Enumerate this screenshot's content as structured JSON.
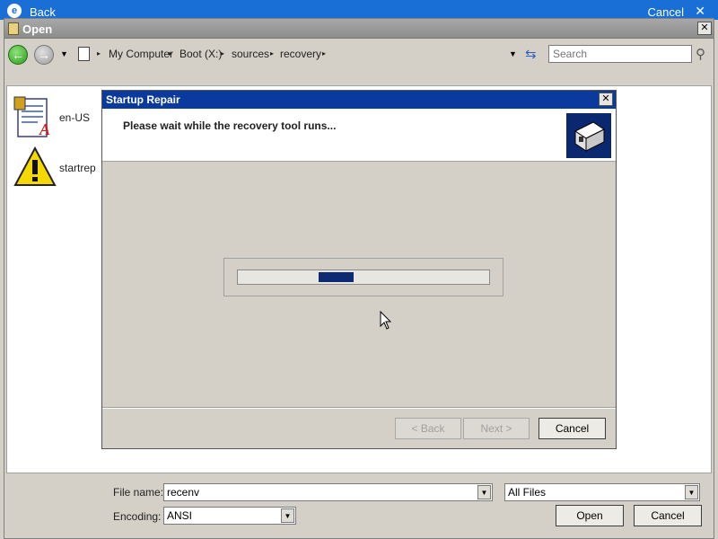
{
  "background_window": {
    "back_label": "Back",
    "cancel_label": "Cancel",
    "close_glyph": "✕"
  },
  "open_dialog": {
    "title": "Open",
    "close_glyph": "✕",
    "nav": {
      "back_glyph": "←",
      "forward_glyph": "→",
      "dropdown_glyph": "▼",
      "breadcrumbs": [
        "My Computer",
        "Boot (X:)",
        "sources",
        "recovery"
      ],
      "crumb_arrow": "▸",
      "refresh_glyph": "⇆",
      "search_placeholder": "Search",
      "search_glyph": "⚲"
    },
    "files": [
      {
        "name": "en-US",
        "icon": "text-document-icon"
      },
      {
        "name": "startrep",
        "icon": "warning-icon"
      }
    ],
    "filename_label": "File name:",
    "filename_value": "recenv",
    "filetype_value": "All Files",
    "encoding_label": "Encoding:",
    "encoding_value": "ANSI",
    "combo_arrow": "▼",
    "open_button": "Open",
    "cancel_button": "Cancel"
  },
  "wizard": {
    "title": "Startup Repair",
    "close_glyph": "✕",
    "heading": "Please wait while the recovery tool runs...",
    "progress_fraction_start": 0.32,
    "progress_fraction_width": 0.14,
    "back_button": "< Back",
    "next_button": "Next >",
    "cancel_button": "Cancel"
  },
  "colors": {
    "wizard_title": "#0b3a9e",
    "progress_fill": "#0d2b72",
    "desktop_bar": "#1a6fd6"
  }
}
